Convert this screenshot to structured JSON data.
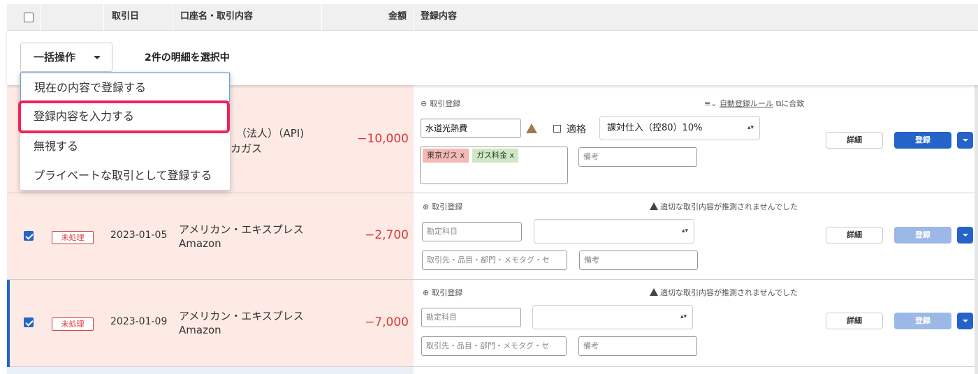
{
  "header": {
    "date": "取引日",
    "account": "口座名・取引内容",
    "amount": "金額",
    "registration": "登録内容"
  },
  "bulk": {
    "button_label": "一括操作",
    "selected_text": "2件の明細を選択中"
  },
  "menu": {
    "items": [
      "現在の内容で登録する",
      "登録内容を入力する",
      "無視する",
      "プライベートな取引として登録する"
    ]
  },
  "rows": [
    {
      "account_line1_partial": "（法人）（API)",
      "account_line2_partial": "カガス",
      "amount": "−10,000",
      "section_label": "取引登録",
      "section_icon": "minus-circle-icon",
      "rule_text_link": "自動登録ルール",
      "rule_text_suffix": "に合致",
      "account_field": "水道光熱費",
      "qualified_label": "適格",
      "tax_select": "課対仕入（控80）10%",
      "tags": [
        "東京ガス x",
        "ガス料金 x"
      ],
      "memo_placeholder": "備考",
      "detail_label": "詳細",
      "register_label": "登録"
    },
    {
      "checked": true,
      "status": "未処理",
      "date": "2023-01-05",
      "account_line1": "アメリカン・エキスプレス",
      "account_line2": "Amazon",
      "amount": "−2,700",
      "section_label": "取引登録",
      "section_icon": "plus-circle-icon",
      "warning": "適切な取引内容が推測されませんでした",
      "account_placeholder": "勘定科目",
      "partner_placeholder": "取引先・品目・部門・メモタグ・セ",
      "memo_placeholder": "備考",
      "detail_label": "詳細",
      "register_label": "登録"
    },
    {
      "checked": true,
      "status": "未処理",
      "date": "2023-01-09",
      "account_line1": "アメリカン・エキスプレス",
      "account_line2": "Amazon",
      "amount": "−7,000",
      "section_label": "取引登録",
      "section_icon": "plus-circle-icon",
      "warning": "適切な取引内容が推測されませんでした",
      "account_placeholder": "勘定科目",
      "partner_placeholder": "取引先・品目・部門・メモタグ・セ",
      "memo_placeholder": "備考",
      "detail_label": "詳細",
      "register_label": "登録"
    }
  ],
  "colors": {
    "accent": "#2563c9",
    "row_bg": "#fdeae5",
    "negative": "#d9383c",
    "highlight": "#f0225a"
  }
}
